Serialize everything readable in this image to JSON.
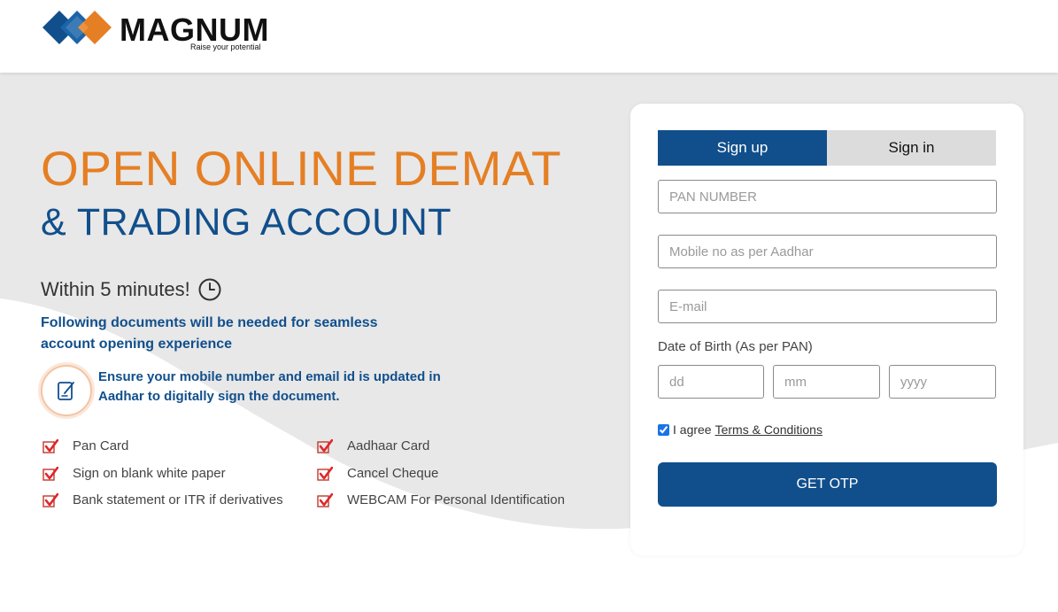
{
  "brand": {
    "name": "MAGNUM",
    "tagline": "Raise your potential",
    "colors": {
      "blue": "#114f8c",
      "orange": "#e57f24"
    },
    "logo_icon": "diamond-squares-icon"
  },
  "hero": {
    "title_line1": "OPEN ONLINE DEMAT",
    "title_line2": "& TRADING ACCOUNT",
    "within": "Within 5 minutes!",
    "within_icon": "clock-icon",
    "docs_intro": "Following documents will be needed for seamless account opening experience",
    "note_icon": "edit-document-icon",
    "note": "Ensure your mobile number and email id is updated in Aadhar to digitally sign the document.",
    "requirements_left": [
      "Pan Card",
      "Sign on blank white paper",
      "Bank statement or ITR if derivatives"
    ],
    "requirements_right": [
      "Aadhaar Card",
      "Cancel Cheque",
      "WEBCAM For Personal Identification"
    ],
    "check_icon": "red-check-icon"
  },
  "form": {
    "tabs": {
      "signup": "Sign up",
      "signin": "Sign in",
      "active": "signup"
    },
    "pan_placeholder": "PAN NUMBER",
    "mobile_placeholder": "Mobile no as per Aadhar",
    "email_placeholder": "E-mail",
    "dob_label": "Date of Birth (As per PAN)",
    "dd_placeholder": "dd",
    "mm_placeholder": "mm",
    "yyyy_placeholder": "yyyy",
    "agree_text": "I agree",
    "terms_link": "Terms & Conditions",
    "agree_checked": true,
    "submit_label": "GET OTP"
  }
}
